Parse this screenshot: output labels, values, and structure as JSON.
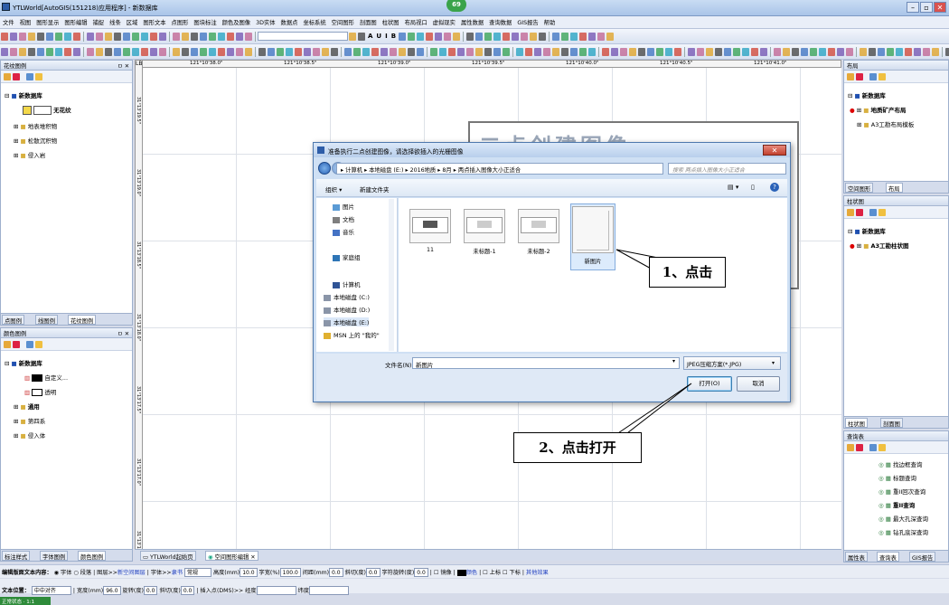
{
  "window": {
    "title": "YTLWorld[AutoGIS(151218)应用程序] - 新数据库",
    "badge": "69",
    "min": "–",
    "restore": "▫",
    "close": "✕"
  },
  "menu": [
    "文件",
    "视图",
    "图形显示",
    "图形编辑",
    "捕捉",
    "线条",
    "区域",
    "图形文本",
    "点图形",
    "图块标注",
    "颜色及图像",
    "3D实体",
    "数据点",
    "坐标系统",
    "空间图形",
    "剖面图",
    "柱状图",
    "布局视口",
    "虚拟现实",
    "属性数据",
    "查询数据",
    "GIS报告",
    "帮助"
  ],
  "toolbar": {
    "bold": "B",
    "italic": "I",
    "underline": "U",
    "fontA": "A"
  },
  "left_panel_top": {
    "title": "花纹图例",
    "pin": "ㅁ ✕",
    "tree": [
      {
        "label": "新数据库",
        "bold": true
      },
      {
        "label": "无花纹",
        "bold": true
      },
      {
        "label": "地表堆积物"
      },
      {
        "label": "松散沉积物"
      },
      {
        "label": "侵入岩"
      }
    ],
    "tabs": [
      "点图例",
      "线图例",
      "花纹图例"
    ]
  },
  "left_panel_bottom": {
    "title": "颜色图例",
    "pin": "ㅁ ✕",
    "tree": [
      {
        "label": "新数据库",
        "bold": true
      },
      {
        "label": "自定义..."
      },
      {
        "label": "透明"
      },
      {
        "label": "通用",
        "bold": true
      },
      {
        "label": "第四系"
      },
      {
        "label": "侵入体"
      }
    ],
    "tabs": [
      "标注样式",
      "字体图例",
      "颜色图例"
    ]
  },
  "right_panel_layout": {
    "title": "布局",
    "tree": [
      {
        "label": "新数据库",
        "bold": true
      },
      {
        "label": "地质矿产布局",
        "bold": true
      },
      {
        "label": "A3工勘布局模板"
      }
    ],
    "tabs": [
      "空间图形",
      "布局"
    ]
  },
  "right_panel_column": {
    "title": "柱状图",
    "tree": [
      {
        "label": "新数据库",
        "bold": true
      },
      {
        "label": "A3工勘柱状图",
        "bold": true
      }
    ],
    "tabs": [
      "柱状图",
      "剖面图"
    ]
  },
  "right_panel_query": {
    "title": "查询表",
    "items": [
      "找边框查询",
      "标题查询",
      "重II回次查询",
      "重II查询",
      "最大孔深查询",
      "钻孔底深查询"
    ],
    "tabs": [
      "属性表",
      "查询表",
      "GIS报告"
    ]
  },
  "canvas": {
    "ruler_top": [
      "121°10'38.0\"",
      "121°10'38.5\"",
      "121°10'39.0\"",
      "121°10'39.5\"",
      "121°10'40.0\"",
      "121°10'40.5\"",
      "121°10'41.0\""
    ],
    "ruler_left": [
      "31°13'19.5\"",
      "31°13'19.0\"",
      "31°13'18.5\"",
      "31°13'18.0\"",
      "31°13'17.5\"",
      "31°13'17.0\"",
      "31°13'16.5\""
    ],
    "ruler_corner": "LB",
    "background_title": "二点创建图像",
    "tabs": [
      "YTLWorld起始页",
      "空间图形编辑"
    ]
  },
  "dialog": {
    "title": "准备执行二点创建图像，请选择欲插入的光栅图像",
    "address": [
      "计算机",
      "本地磁盘 (E:)",
      "2016地质",
      "8月",
      "两点插入图像大小正适合"
    ],
    "search_placeholder": "搜索 两点插入图像大小正适合",
    "organize": "组织 ▾",
    "new_folder": "新建文件夹",
    "nav": [
      {
        "label": "图片"
      },
      {
        "label": "文档"
      },
      {
        "label": "音乐"
      },
      {
        "label": "家庭组"
      },
      {
        "label": "计算机"
      },
      {
        "label": "本地磁盘 (C:)"
      },
      {
        "label": "本地磁盘 (D:)"
      },
      {
        "label": "本地磁盘 (E:)"
      },
      {
        "label": "MSN 上的 \"我的\""
      }
    ],
    "files": [
      "11",
      "未标题-1",
      "未标题-2",
      "新图片"
    ],
    "filename_label": "文件名(N):",
    "filename_value": "新图片",
    "filetype": "JPEG压缩方案(*.JPG)",
    "open_button": "打开(O)",
    "cancel_button": "取消"
  },
  "callouts": [
    "1、点击",
    "2、点击打开"
  ],
  "status1": {
    "label": "编辑版面文本内容：",
    "opt_font": "字体",
    "opt_para": "段落",
    "layer_label": "图层>>",
    "layer_value": "新空间图层",
    "font_label": "字体>>",
    "font_value": "隶书",
    "style_value": "常规",
    "height_label": "高度(mm)",
    "height_value": "10.0",
    "width_label": "字宽(%)",
    "width_value": "100.0",
    "space_label": "间距(mm)",
    "space_value": "0.0",
    "slant_label": "斜切(度)",
    "slant_value": "0.0",
    "rot_label": "字符旋转(度)",
    "rot_value": "0.0",
    "mirror": "镜像",
    "color": "颜色",
    "sup": "上标",
    "sub": "下标",
    "other": "其他效果"
  },
  "status2": {
    "label": "文本位置：",
    "align_value": "中中对齐",
    "w_label": "宽度(mm)",
    "w_value": "96.0",
    "rot_label": "旋转(度)",
    "rot_value": "0.0",
    "slant_label": "斜切(度)",
    "slant_value": "0.0",
    "insert_label": "插入点(DMS)>>",
    "lon_label": "经度",
    "lat_label": "纬度"
  },
  "status3": {
    "text": "正常状态 · 1:1"
  }
}
